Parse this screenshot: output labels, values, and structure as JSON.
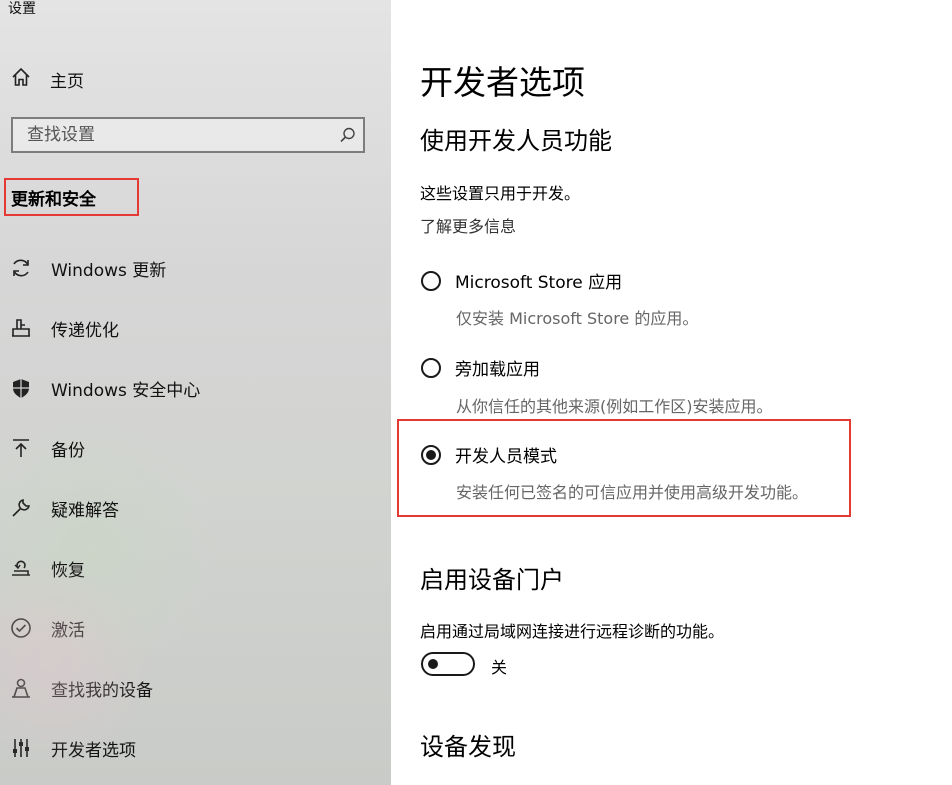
{
  "window": {
    "title": "设置"
  },
  "sidebar": {
    "home_label": "主页",
    "search_placeholder": "查找设置",
    "section_header": "更新和安全",
    "items": [
      {
        "label": "Windows 更新",
        "icon": "refresh-icon"
      },
      {
        "label": "传递优化",
        "icon": "delivery-icon"
      },
      {
        "label": "Windows 安全中心",
        "icon": "shield-icon"
      },
      {
        "label": "备份",
        "icon": "backup-arrow-icon"
      },
      {
        "label": "疑难解答",
        "icon": "wrench-icon"
      },
      {
        "label": "恢复",
        "icon": "recovery-icon"
      },
      {
        "label": "激活",
        "icon": "check-circle-icon"
      },
      {
        "label": "查找我的设备",
        "icon": "person-locate-icon"
      },
      {
        "label": "开发者选项",
        "icon": "developer-sliders-icon"
      }
    ]
  },
  "main": {
    "title": "开发者选项",
    "dev_features": {
      "heading": "使用开发人员功能",
      "description": "这些设置只用于开发。",
      "learn_more": "了解更多信息",
      "options": [
        {
          "label": "Microsoft Store 应用",
          "description": "仅安装 Microsoft Store 的应用。",
          "selected": false
        },
        {
          "label": "旁加载应用",
          "description": "从你信任的其他来源(例如工作区)安装应用。",
          "selected": false
        },
        {
          "label": "开发人员模式",
          "description": "安装任何已签名的可信应用并使用高级开发功能。",
          "selected": true
        }
      ]
    },
    "device_portal": {
      "heading": "启用设备门户",
      "description": "启用通过局域网连接进行远程诊断的功能。",
      "toggle_state": "关"
    },
    "device_discovery": {
      "heading": "设备发现"
    }
  },
  "colors": {
    "highlight": "#e53935",
    "sidebar_bg": "#d8d8d8",
    "text": "#000000",
    "secondary_text": "#666666"
  }
}
